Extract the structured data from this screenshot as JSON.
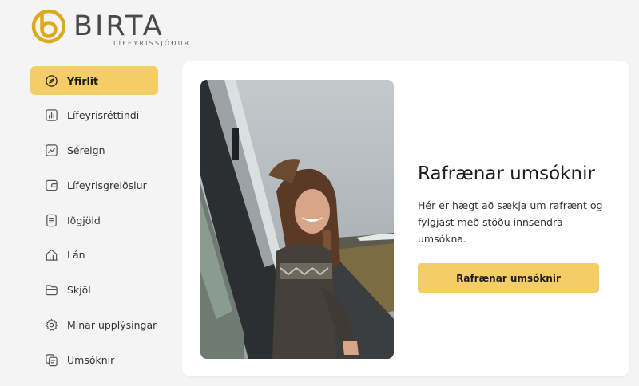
{
  "brand": {
    "name": "BIRTA",
    "tagline": "LÍFEYRISSJÓÐUR",
    "accent_color": "#f5cd66",
    "logo_color": "#e0a81c"
  },
  "sidebar": {
    "items": [
      {
        "label": "Yfirlit",
        "icon": "compass-icon",
        "active": true
      },
      {
        "label": "Lífeyrisréttindi",
        "icon": "bar-chart-icon",
        "active": false
      },
      {
        "label": "Séreign",
        "icon": "trend-chart-icon",
        "active": false
      },
      {
        "label": "Lífeyrisgreiðslur",
        "icon": "wallet-icon",
        "active": false
      },
      {
        "label": "Iðgjöld",
        "icon": "document-list-icon",
        "active": false
      },
      {
        "label": "Lán",
        "icon": "house-icon",
        "active": false
      },
      {
        "label": "Skjöl",
        "icon": "folder-icon",
        "active": false
      },
      {
        "label": "Mínar upplýsingar",
        "icon": "gear-icon",
        "active": false
      },
      {
        "label": "Umsóknir",
        "icon": "copy-documents-icon",
        "active": false
      }
    ]
  },
  "main": {
    "card": {
      "photo": "smiling-woman-leaning-out-of-car-window",
      "heading": "Rafrænar umsóknir",
      "description": "Hér er hægt að sækja um rafrænt og fylgjast með stöðu innsendra umsókna.",
      "button_label": "Rafrænar umsóknir"
    }
  }
}
